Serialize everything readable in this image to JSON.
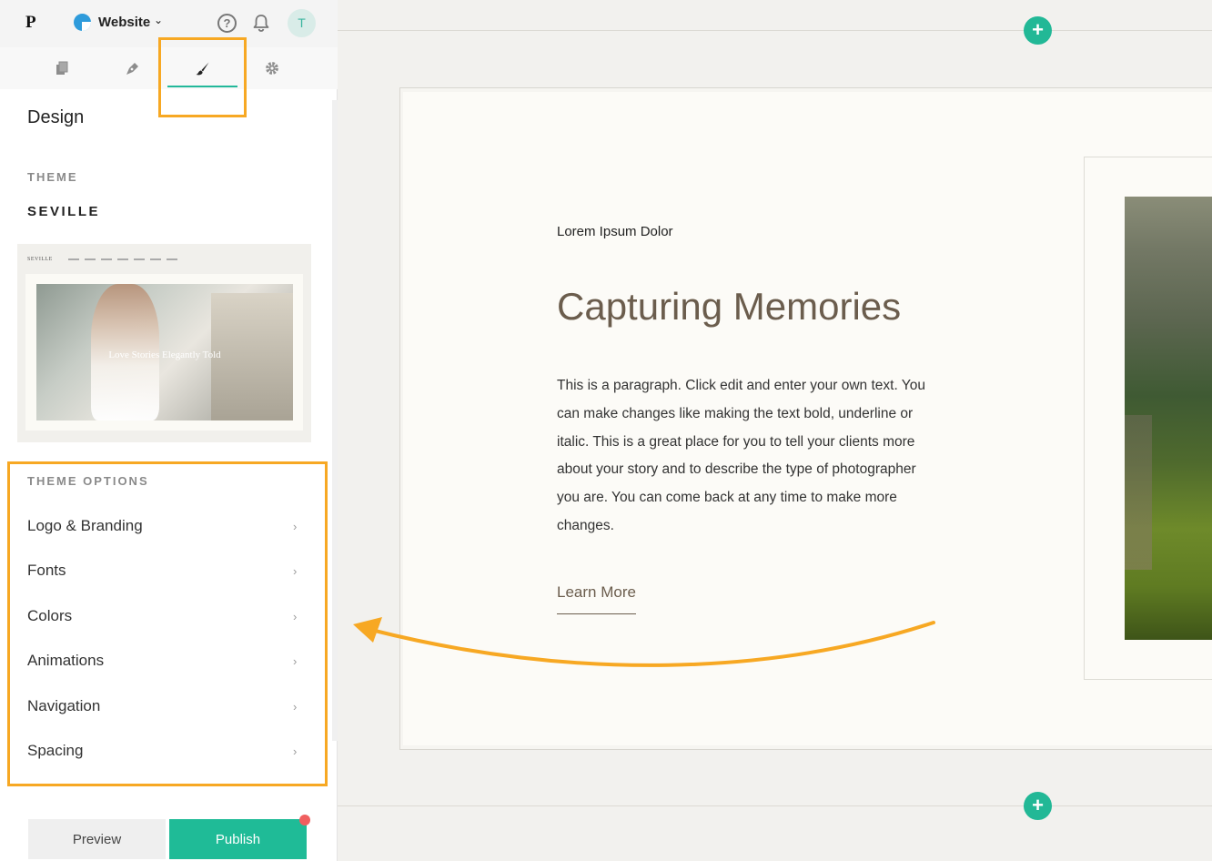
{
  "topbar": {
    "brand_letter": "P",
    "site_name": "Website",
    "site_chevron": "⌄",
    "help_glyph": "?",
    "avatar_initial": "T"
  },
  "tabs": [
    {
      "name": "pages",
      "icon": "pages-icon",
      "active": false
    },
    {
      "name": "content",
      "icon": "pen-icon",
      "active": false
    },
    {
      "name": "design",
      "icon": "brush-icon",
      "active": true
    },
    {
      "name": "settings",
      "icon": "gear-icon",
      "active": false
    }
  ],
  "panel": {
    "title": "Design",
    "theme_label": "THEME",
    "theme_name": "SEVILLE",
    "theme_preview": {
      "logo_text": "SEVILLE",
      "caption": "Love Stories Elegantly Told"
    },
    "options_label": "THEME OPTIONS",
    "options": [
      {
        "label": "Logo & Branding"
      },
      {
        "label": "Fonts"
      },
      {
        "label": "Colors"
      },
      {
        "label": "Animations"
      },
      {
        "label": "Navigation"
      },
      {
        "label": "Spacing"
      }
    ],
    "option_chevron": "›"
  },
  "footer": {
    "preview_label": "Preview",
    "publish_label": "Publish"
  },
  "canvas": {
    "add_section_glyph": "+",
    "eyebrow": "Lorem Ipsum Dolor",
    "title": "Capturing Memories",
    "body": "This is a paragraph. Click edit and enter your own text. You can make changes like making the text bold, underline or italic. This is a great place for you to tell your clients more about your story and to describe the type of photographer you are. You can come back at any time to make more changes.",
    "cta": "Learn More"
  },
  "colors": {
    "accent": "#1fbb97",
    "highlight": "#f7a823",
    "heading": "#6b5d4d",
    "notification": "#f05f5f"
  }
}
